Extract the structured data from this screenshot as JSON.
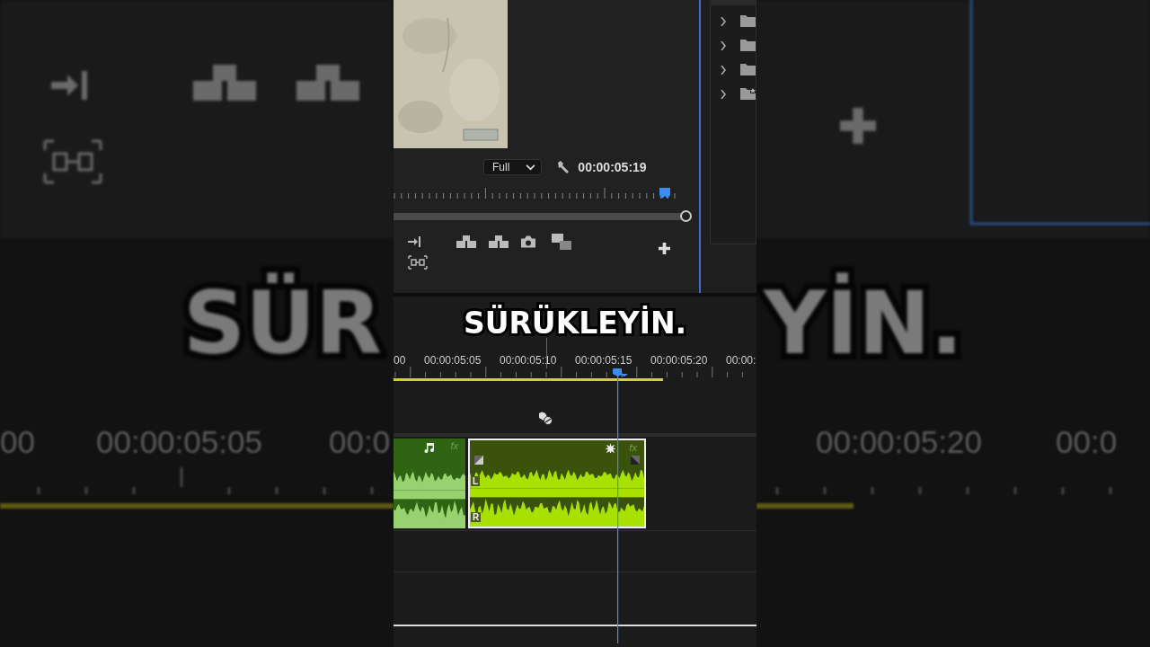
{
  "backdrop_left": {
    "caption": "SÜR",
    "timecodes": [
      "00",
      "00:00:05:05",
      "00:0"
    ]
  },
  "backdrop_right": {
    "caption": "YİN.",
    "timecodes": [
      "00:00:05:20",
      "00:0"
    ]
  },
  "program_monitor": {
    "zoom": "Full",
    "timecode": "00:00:05:19"
  },
  "project_panel": {
    "items": [
      {
        "kind": "folder",
        "expanded": false
      },
      {
        "kind": "folder",
        "expanded": false
      },
      {
        "kind": "folder",
        "expanded": false
      },
      {
        "kind": "search_bin",
        "expanded": false
      }
    ]
  },
  "caption": "SÜRÜKLEYİN.",
  "timeline": {
    "timecodes": [
      "00",
      "00:00:05:05",
      "00:00:05:10",
      "00:00:05:15",
      "00:00:05:20",
      "00:00:"
    ],
    "clips": [
      {
        "selected": false,
        "fx_label": "fx"
      },
      {
        "selected": true,
        "fx_label": "fx",
        "channels": [
          "L",
          "R"
        ]
      }
    ]
  }
}
